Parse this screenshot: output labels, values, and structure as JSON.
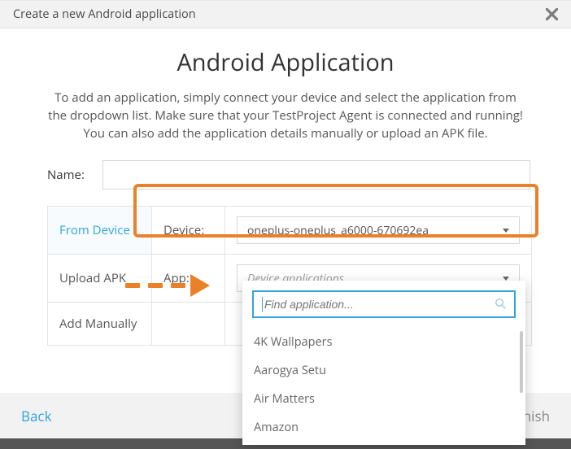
{
  "header": {
    "title": "Create a new Android application"
  },
  "page": {
    "heading": "Android Application",
    "description": "To add an application, simply connect your device and select the application from the dropdown list. Make sure that your TestProject Agent is connected and running! You can also add the application details manually or upload an APK file."
  },
  "form": {
    "name_label": "Name:",
    "name_value": "",
    "tabs": {
      "from_device": "From Device",
      "upload_apk": "Upload APK",
      "add_manually": "Add Manually"
    },
    "device_label": "Device:",
    "device_value": "oneplus-oneplus_a6000-670692ea",
    "app_label": "App:",
    "app_placeholder": "Device applications"
  },
  "dropdown": {
    "search_placeholder": "Find application...",
    "items": [
      "4K Wallpapers",
      "Aarogya Setu",
      "Air Matters",
      "Amazon"
    ]
  },
  "footer": {
    "back": "Back",
    "finish": "Finish"
  }
}
